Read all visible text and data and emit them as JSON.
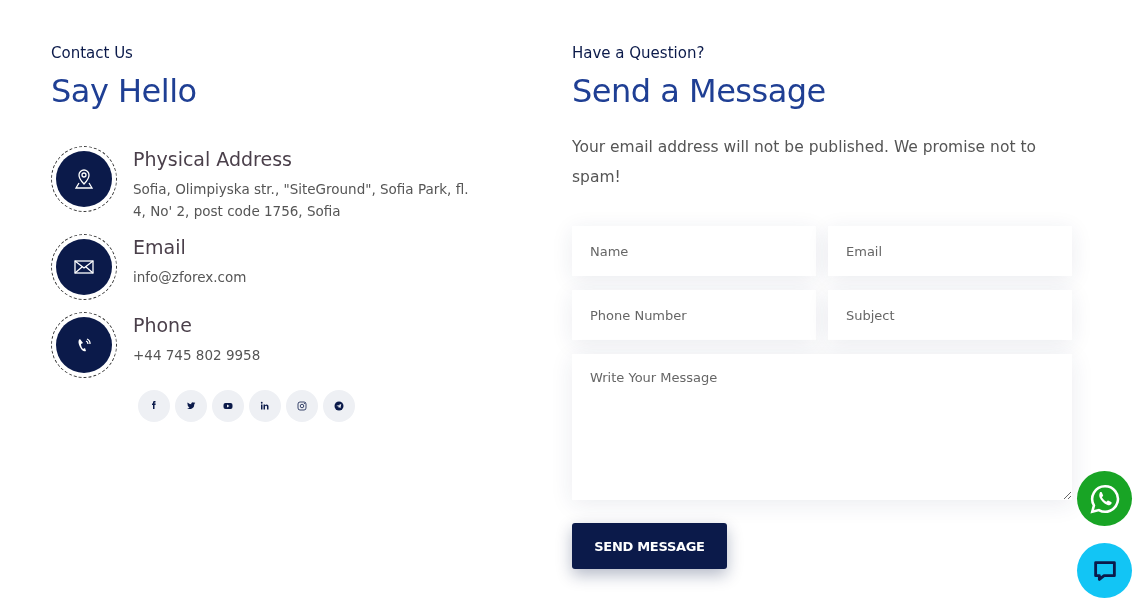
{
  "contact": {
    "eyebrow": "Contact Us",
    "heading": "Say Hello",
    "items": [
      {
        "kind": "address",
        "title": "Physical Address",
        "text": "Sofia, Olimpiyska str., \"SiteGround\", Sofia Park, fl. 4, No' 2, post code 1756, Sofia"
      },
      {
        "kind": "email",
        "title": "Email",
        "text": "info@zforex.com"
      },
      {
        "kind": "phone",
        "title": "Phone",
        "text": "+44 745 802 9958"
      }
    ],
    "socials": [
      {
        "kind": "facebook"
      },
      {
        "kind": "twitter"
      },
      {
        "kind": "youtube"
      },
      {
        "kind": "linkedin"
      },
      {
        "kind": "instagram"
      },
      {
        "kind": "telegram"
      }
    ]
  },
  "form": {
    "eyebrow": "Have a Question?",
    "heading": "Send a Message",
    "intro": "Your email address will not be published. We promise not to spam!",
    "fields": [
      {
        "kind": "input",
        "placeholder": "Name"
      },
      {
        "kind": "input",
        "placeholder": "Email"
      },
      {
        "kind": "input",
        "placeholder": "Phone Number"
      },
      {
        "kind": "input",
        "placeholder": "Subject"
      },
      {
        "kind": "textarea",
        "placeholder": "Write Your Message"
      }
    ],
    "submit": "SEND MESSAGE"
  },
  "floating": [
    {
      "kind": "whatsapp"
    },
    {
      "kind": "chat"
    }
  ]
}
